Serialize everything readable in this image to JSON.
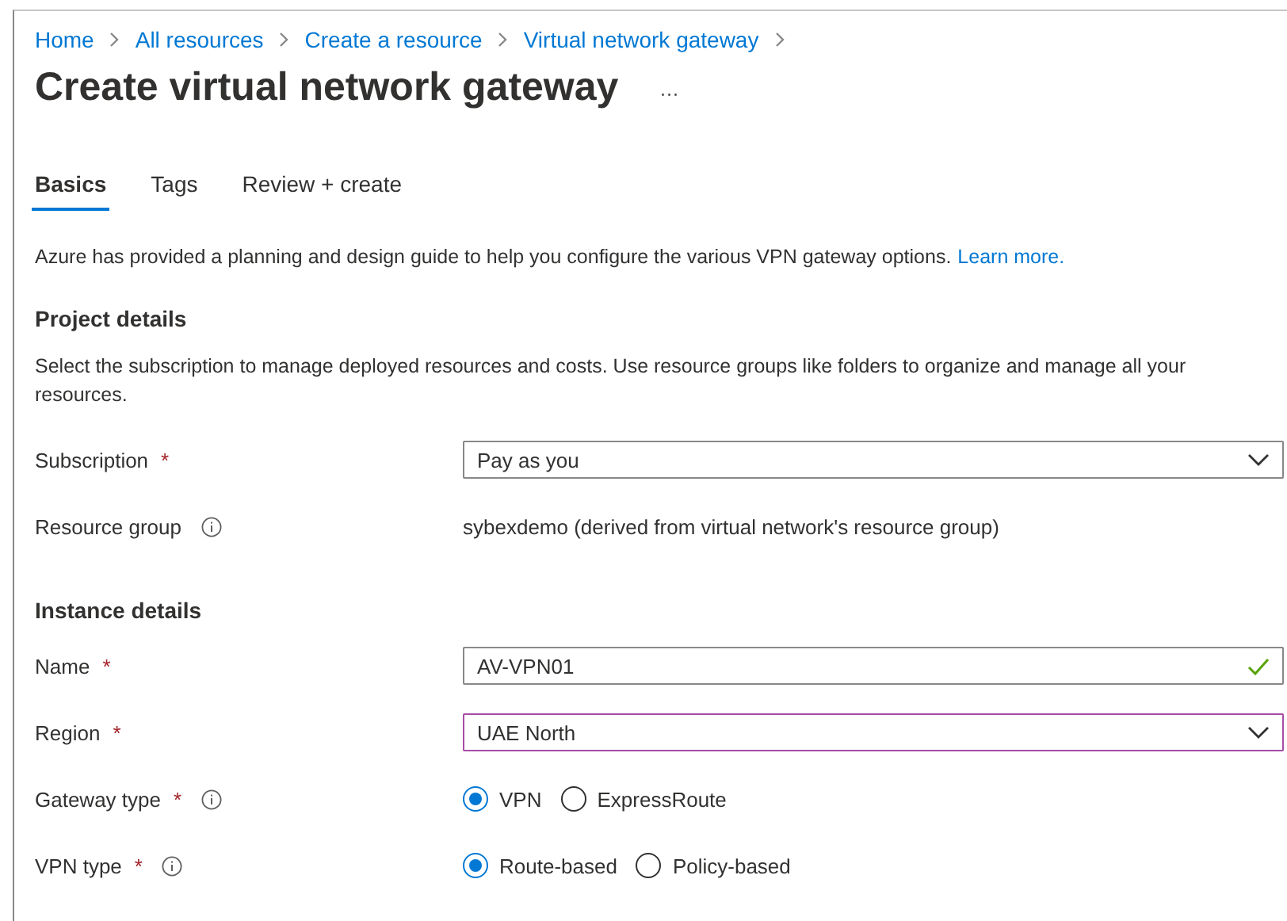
{
  "breadcrumb": [
    {
      "label": "Home"
    },
    {
      "label": "All resources"
    },
    {
      "label": "Create a resource"
    },
    {
      "label": "Virtual network gateway"
    }
  ],
  "title": "Create virtual network gateway",
  "more": "···",
  "tabs": [
    {
      "label": "Basics",
      "selected": true
    },
    {
      "label": "Tags",
      "selected": false
    },
    {
      "label": "Review + create",
      "selected": false
    }
  ],
  "intro": {
    "text": "Azure has provided a planning and design guide to help you configure the various VPN gateway options.",
    "link": "Learn more."
  },
  "sections": [
    {
      "heading": "Project details",
      "description": "Select the subscription to manage deployed resources and costs. Use resource groups like folders to organize and manage all your resources.",
      "rows": [
        {
          "kind": "dropdown",
          "label": "Subscription",
          "required": "*",
          "info": false,
          "value": "Pay as you",
          "focused": false
        },
        {
          "kind": "static",
          "label": "Resource group",
          "info": true,
          "value": "sybexdemo (derived from virtual network's resource group)"
        }
      ]
    },
    {
      "heading": "Instance details",
      "rows": [
        {
          "kind": "text",
          "label": "Name",
          "required": "*",
          "info": false,
          "value": "AV-VPN01",
          "valid": true,
          "focused": false
        },
        {
          "kind": "dropdown",
          "label": "Region",
          "required": "*",
          "info": false,
          "value": "UAE North",
          "focused": true
        },
        {
          "kind": "radio",
          "label": "Gateway type",
          "required": "*",
          "info": true,
          "options": [
            {
              "label": "VPN",
              "selected": true
            },
            {
              "label": "ExpressRoute",
              "selected": false
            }
          ]
        },
        {
          "kind": "radio",
          "label": "VPN type",
          "required": "*",
          "info": true,
          "options": [
            {
              "label": "Route-based",
              "selected": true
            },
            {
              "label": "Policy-based",
              "selected": false
            }
          ]
        }
      ]
    }
  ]
}
